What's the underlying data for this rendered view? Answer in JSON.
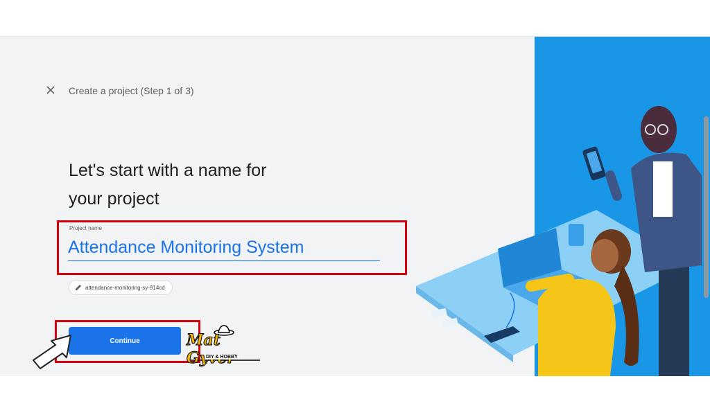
{
  "header": {
    "close_icon": "close-icon",
    "step_title": "Create a project (Step 1 of 3)"
  },
  "main": {
    "heading_line1": "Let's start with a name for",
    "heading_line2": "your project",
    "project_name_label": "Project name",
    "project_name_value": "Attendance Monitoring System",
    "project_id_chip": "attendance-monitoring-sy-914cd",
    "edit_icon": "pencil-icon",
    "continue_label": "Continue"
  },
  "watermark": {
    "title": "Mat Gyver",
    "subtitle": "DIY & HOBBY"
  },
  "colors": {
    "accent": "#1a73e8",
    "highlight": "#d9000d",
    "illustration_bg": "#1a96e6"
  }
}
